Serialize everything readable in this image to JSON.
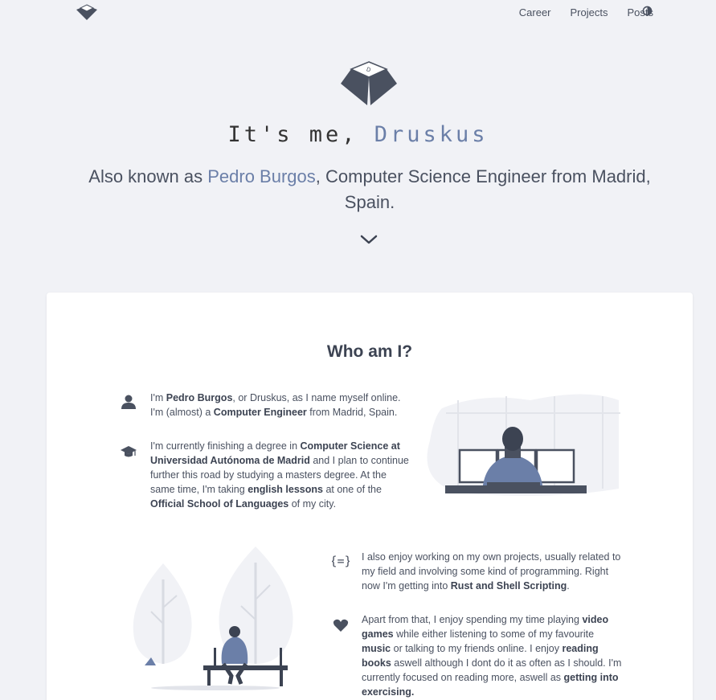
{
  "nav": {
    "links": [
      "Career",
      "Projects",
      "Posts"
    ],
    "theme_icon": "contrast-icon",
    "logo_icon": "keycap-logo-icon"
  },
  "hero": {
    "title_prefix": "It's me, ",
    "title_name": "Druskus",
    "sub_prefix": "Also known as ",
    "sub_name": "Pedro Burgos",
    "sub_suffix": ", Computer Science Engineer from Madrid, Spain.",
    "chevron_icon": "chevron-down-icon"
  },
  "about": {
    "title": "Who am I?",
    "items": [
      {
        "icon": "user-icon",
        "parts": [
          {
            "t": "I'm ",
            "b": false
          },
          {
            "t": "Pedro Burgos",
            "b": true
          },
          {
            "t": ", or Druskus, as I name myself online. I'm (almost) a ",
            "b": false
          },
          {
            "t": "Computer Engineer",
            "b": true
          },
          {
            "t": " from Madrid, Spain.",
            "b": false
          }
        ]
      },
      {
        "icon": "graduation-cap-icon",
        "parts": [
          {
            "t": "I'm currently finishing a degree in ",
            "b": false
          },
          {
            "t": "Computer Science at Universidad Autónoma de Madrid",
            "b": true
          },
          {
            "t": " and I plan to continue further this road by studying a masters degree. At the same time, I'm taking ",
            "b": false
          },
          {
            "t": "english lessons",
            "b": true
          },
          {
            "t": " at one of the ",
            "b": false
          },
          {
            "t": "Official School of Languages",
            "b": true
          },
          {
            "t": " of my city.",
            "b": false
          }
        ]
      },
      {
        "icon": "code-braces-icon",
        "parts": [
          {
            "t": "I also enjoy working on my own projects, usually related to my field and involving some kind of programming. Right now I'm getting into ",
            "b": false
          },
          {
            "t": "Rust and Shell Scripting",
            "b": true
          },
          {
            "t": ".",
            "b": false
          }
        ]
      },
      {
        "icon": "heart-icon",
        "parts": [
          {
            "t": "Apart from that, I enjoy spending my time playing ",
            "b": false
          },
          {
            "t": "video games",
            "b": true
          },
          {
            "t": " while either listening to some of my favourite ",
            "b": false
          },
          {
            "t": "music",
            "b": true
          },
          {
            "t": " or talking to my friends online. I enjoy ",
            "b": false
          },
          {
            "t": "reading books",
            "b": true
          },
          {
            "t": " aswell although I dont do it as often as I should. I'm currently focused on reading more, aswell as ",
            "b": false
          },
          {
            "t": "getting into exercising.",
            "b": true
          }
        ]
      }
    ]
  }
}
